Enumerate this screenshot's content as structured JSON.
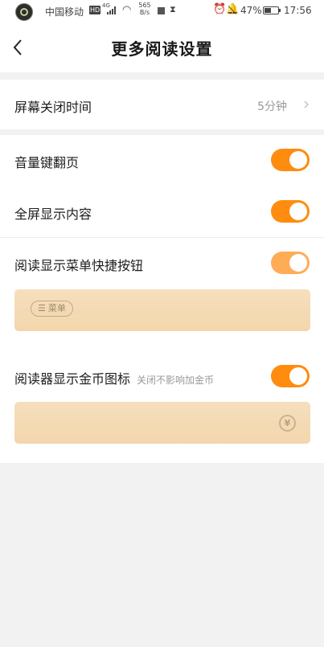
{
  "status_bar": {
    "carrier": "中国移动",
    "hd": "HD",
    "network": "4G",
    "speed_value": "565",
    "speed_unit": "B/s",
    "battery_percent": "47%",
    "time": "17:56"
  },
  "header": {
    "back_icon": "chevron-left-icon",
    "title": "更多阅读设置"
  },
  "screen_timeout": {
    "label": "屏幕关闭时间",
    "value": "5分钟"
  },
  "toggles": {
    "volume_page_turn": {
      "label": "音量键翻页",
      "on": true
    },
    "fullscreen": {
      "label": "全屏显示内容",
      "on": true
    },
    "menu_shortcut": {
      "label": "阅读显示菜单快捷按钮",
      "on": true
    },
    "coin_icon": {
      "label": "阅读器显示金币图标",
      "hint": "关闭不影响加金币",
      "on": true
    }
  },
  "previews": {
    "menu_pill_icon": "menu-lines-icon",
    "menu_pill_label": "菜单",
    "coin_symbol": "¥"
  },
  "colors": {
    "accent": "#ff8c0f",
    "accent_faded": "#ffac57",
    "preview_bg": "#f5dbb5"
  }
}
